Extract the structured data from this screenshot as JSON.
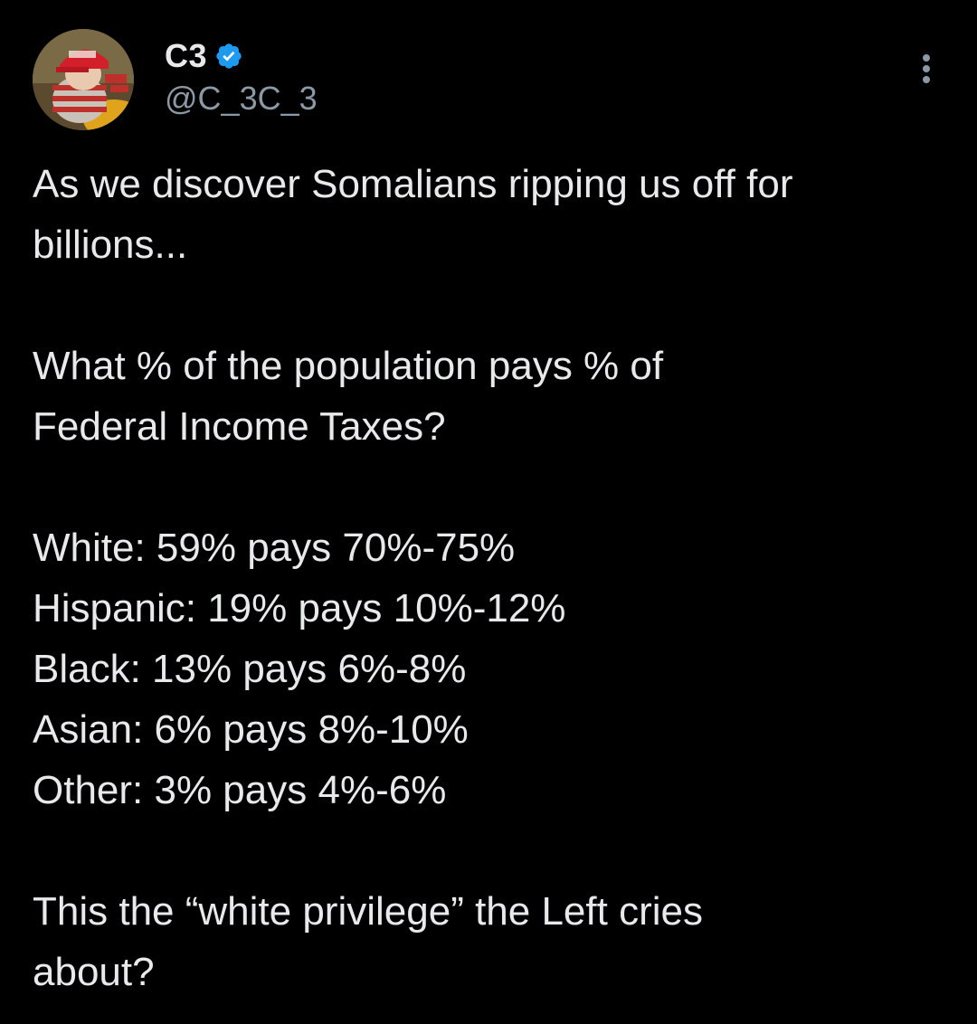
{
  "author": {
    "display_name": "C3",
    "handle": "@C_3C_3",
    "verified": true,
    "verified_color": "#1d9bf0"
  },
  "menu": {
    "more_icon": "more-vertical-icon"
  },
  "tweet": {
    "paragraphs": [
      [
        "As we discover Somalians ripping us off for",
        "billions..."
      ],
      [
        "What % of the population pays % of",
        "Federal Income Taxes?"
      ],
      [
        "White: 59% pays 70%-75%",
        "Hispanic: 19% pays 10%-12%",
        "Black: 13% pays 6%-8%",
        "Asian: 6% pays 8%-10%",
        "Other: 3% pays 4%-6%"
      ],
      [
        "This the “white privilege” the Left cries",
        "about?"
      ]
    ]
  },
  "theme": {
    "background": "#000000",
    "text_primary": "#e7e9ea",
    "text_secondary": "#8b98a5"
  }
}
